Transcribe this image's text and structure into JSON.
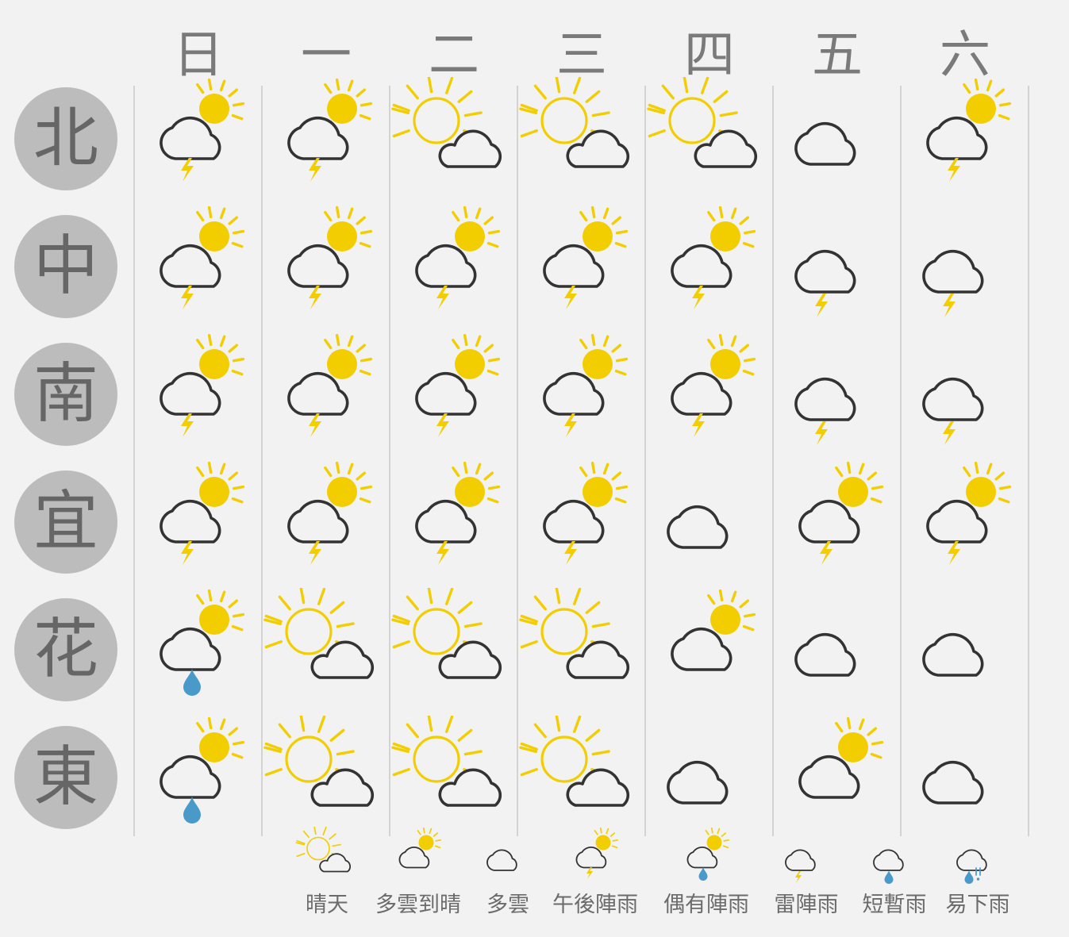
{
  "days": [
    "日",
    "一",
    "二",
    "三",
    "四",
    "五",
    "六"
  ],
  "regions": [
    "北",
    "中",
    "南",
    "宜",
    "花",
    "東"
  ],
  "forecast": [
    [
      "thunder_sun",
      "thunder_sun",
      "sunny",
      "sunny",
      "sunny",
      "cloudy",
      "thunder_sun"
    ],
    [
      "thunder_sun",
      "thunder_sun",
      "thunder_sun",
      "thunder_sun",
      "thunder_sun",
      "thunder",
      "thunder"
    ],
    [
      "thunder_sun",
      "thunder_sun",
      "thunder_sun",
      "thunder_sun",
      "thunder_sun",
      "thunder",
      "thunder"
    ],
    [
      "thunder_sun",
      "thunder_sun",
      "thunder_sun",
      "thunder_sun",
      "cloudy",
      "thunder_sun",
      "thunder_sun"
    ],
    [
      "shower_sun",
      "sunny",
      "sunny",
      "sunny",
      "cloudy_sun",
      "cloudy",
      "cloudy"
    ],
    [
      "shower_sun",
      "sunny",
      "sunny",
      "sunny",
      "cloudy",
      "cloudy_sun",
      "cloudy"
    ]
  ],
  "legend": [
    {
      "icon": "sunny",
      "label": "晴天"
    },
    {
      "icon": "cloudy_sun",
      "label": "多雲到晴"
    },
    {
      "icon": "cloudy",
      "label": "多雲"
    },
    {
      "icon": "thunder_sun",
      "label": "午後陣雨"
    },
    {
      "icon": "shower_sun",
      "label": "偶有陣雨"
    },
    {
      "icon": "thunder",
      "label": "雷陣雨"
    },
    {
      "icon": "shower",
      "label": "短暫雨"
    },
    {
      "icon": "rain_heavy",
      "label": "易下雨"
    }
  ],
  "colors": {
    "sun": "#f2cd00",
    "cloud_stroke": "#333333",
    "rain": "#4a9ac9",
    "circle_bg": "#bcbcbc",
    "header_text": "#7a7a7a",
    "background": "#f2f2f2"
  }
}
